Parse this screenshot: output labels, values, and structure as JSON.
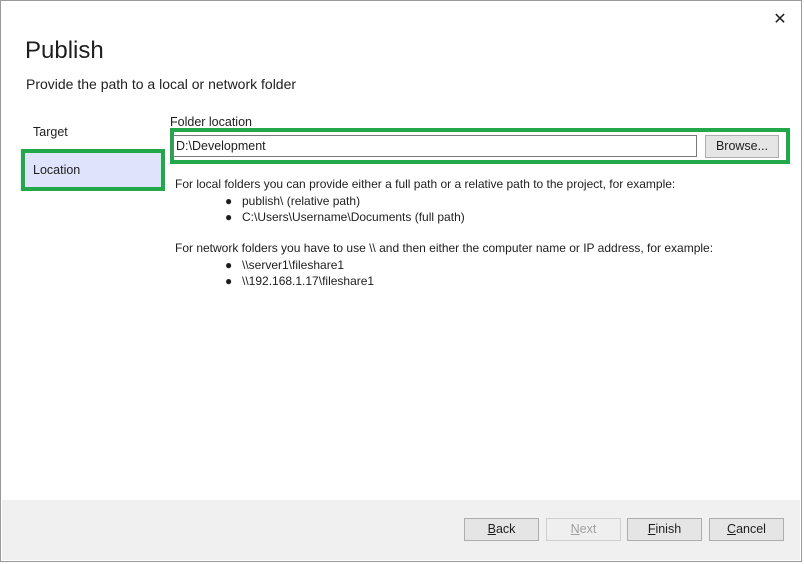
{
  "dialog": {
    "title": "Publish",
    "subtitle": "Provide the path to a local or network folder",
    "close_glyph": "✕"
  },
  "nav": {
    "items": [
      {
        "label": "Target",
        "selected": false
      },
      {
        "label": "Location",
        "selected": true
      }
    ]
  },
  "location": {
    "folder_label": "Folder location",
    "path_value": "D:\\Development",
    "browse_label": "Browse..."
  },
  "help": {
    "local_intro": "For local folders you can provide either a full path or a relative path to the project, for example:",
    "local_examples": [
      "publish\\ (relative path)",
      "C:\\Users\\Username\\Documents (full path)"
    ],
    "network_intro": "For network folders you have to use \\\\ and then either the computer name or IP address, for example:",
    "network_examples": [
      "\\\\server1\\fileshare1",
      "\\\\192.168.1.17\\fileshare1"
    ],
    "bullet_glyph": "●"
  },
  "footer": {
    "back_first": "B",
    "back_rest": "ack",
    "next_first": "N",
    "next_rest": "ext",
    "finish_first": "F",
    "finish_rest": "inish",
    "cancel_first": "C",
    "cancel_rest": "ancel"
  },
  "colors": {
    "highlight_green": "#22a84a",
    "selected_nav_bg": "#dfe3fb",
    "footer_bg": "#f0f0f0"
  }
}
